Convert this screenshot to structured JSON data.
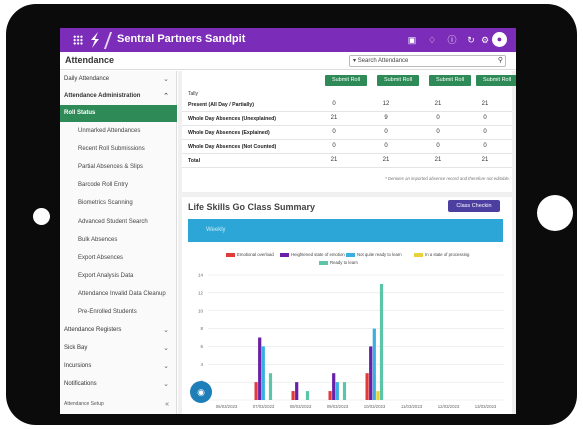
{
  "app": {
    "title": "Sentral Partners Sandpit",
    "page_title": "Attendance"
  },
  "topbar_icons": [
    "window-icon",
    "bell-icon",
    "help-icon",
    "refresh-icon",
    "settings-icon",
    "user-avatar-icon"
  ],
  "search": {
    "value": "Search Attendance"
  },
  "sidebar": {
    "items": [
      {
        "label": "Daily Attendance",
        "type": "section",
        "chevron": "⌄"
      },
      {
        "label": "Attendance Administration",
        "type": "section-open",
        "chevron": "⌃"
      },
      {
        "label": "Roll Status",
        "type": "active"
      },
      {
        "label": "Unmarked Attendances",
        "type": "sub"
      },
      {
        "label": "Recent Roll Submissions",
        "type": "sub"
      },
      {
        "label": "Partial Absences & Slips",
        "type": "sub"
      },
      {
        "label": "Barcode Roll Entry",
        "type": "sub"
      },
      {
        "label": "Biometrics Scanning",
        "type": "sub"
      },
      {
        "label": "Advanced Student Search",
        "type": "sub"
      },
      {
        "label": "Bulk Absences",
        "type": "sub"
      },
      {
        "label": "Export Absences",
        "type": "sub"
      },
      {
        "label": "Export Analysis Data",
        "type": "sub"
      },
      {
        "label": "Attendance Invalid Data Cleanup",
        "type": "sub"
      },
      {
        "label": "Pre-Enrolled Students",
        "type": "sub"
      },
      {
        "label": "Attendance Registers",
        "type": "section",
        "chevron": "⌄"
      },
      {
        "label": "Sick Bay",
        "type": "section",
        "chevron": "⌄"
      },
      {
        "label": "Incursions",
        "type": "section",
        "chevron": "⌄"
      },
      {
        "label": "Notifications",
        "type": "section",
        "chevron": "⌄"
      },
      {
        "label": "Attendance Setup",
        "type": "footer",
        "chevron": "«"
      }
    ]
  },
  "roll": {
    "submit_label": "Submit Roll",
    "tally_label": "Tally",
    "rows": [
      {
        "label": "Present (All Day / Partially)",
        "values": [
          "0",
          "12",
          "21",
          "21"
        ]
      },
      {
        "label": "Whole Day Absences (Unexplained)",
        "values": [
          "21",
          "9",
          "0",
          "0"
        ]
      },
      {
        "label": "Whole Day Absences (Explained)",
        "values": [
          "0",
          "0",
          "0",
          "0"
        ]
      },
      {
        "label": "Whole Day Absences (Not Counted)",
        "values": [
          "0",
          "0",
          "0",
          "0"
        ]
      },
      {
        "label": "Total",
        "values": [
          "21",
          "21",
          "21",
          "21"
        ]
      }
    ],
    "note": "* Denotes an imported absence record and therefore not editable."
  },
  "life_skills": {
    "title": "Life Skills Go Class Summary",
    "button": "Class Checkin",
    "period_label": "Weekly"
  },
  "chart_data": {
    "type": "bar",
    "categories": [
      "06/03/2023",
      "07/03/2023",
      "08/03/2023",
      "09/03/2023",
      "10/03/2023",
      "11/03/2023",
      "12/03/2023",
      "13/03/2023"
    ],
    "series": [
      {
        "name": "Emotional overload",
        "color": "#e03a3a",
        "values": [
          0,
          2,
          1,
          1,
          3,
          0,
          0,
          0
        ]
      },
      {
        "name": "Heightened state of emotion",
        "color": "#6a1fa8",
        "values": [
          0,
          7,
          2,
          3,
          6,
          0,
          0,
          0
        ]
      },
      {
        "name": "Not quite ready to learn",
        "color": "#3ab0e0",
        "values": [
          0,
          6,
          0,
          2,
          8,
          0,
          0,
          0
        ]
      },
      {
        "name": "In a state of processing",
        "color": "#e8d23a",
        "values": [
          0,
          0,
          0,
          0,
          1,
          0,
          0,
          0
        ]
      },
      {
        "name": "Ready to learn",
        "color": "#5cc5a8",
        "values": [
          0,
          3,
          1,
          2,
          13,
          0,
          0,
          0
        ]
      }
    ],
    "yticks": [
      "0",
      "2",
      "4",
      "6",
      "8",
      "10",
      "12",
      "14"
    ],
    "ylim": [
      0,
      14
    ],
    "grid": true,
    "legend": "top"
  }
}
